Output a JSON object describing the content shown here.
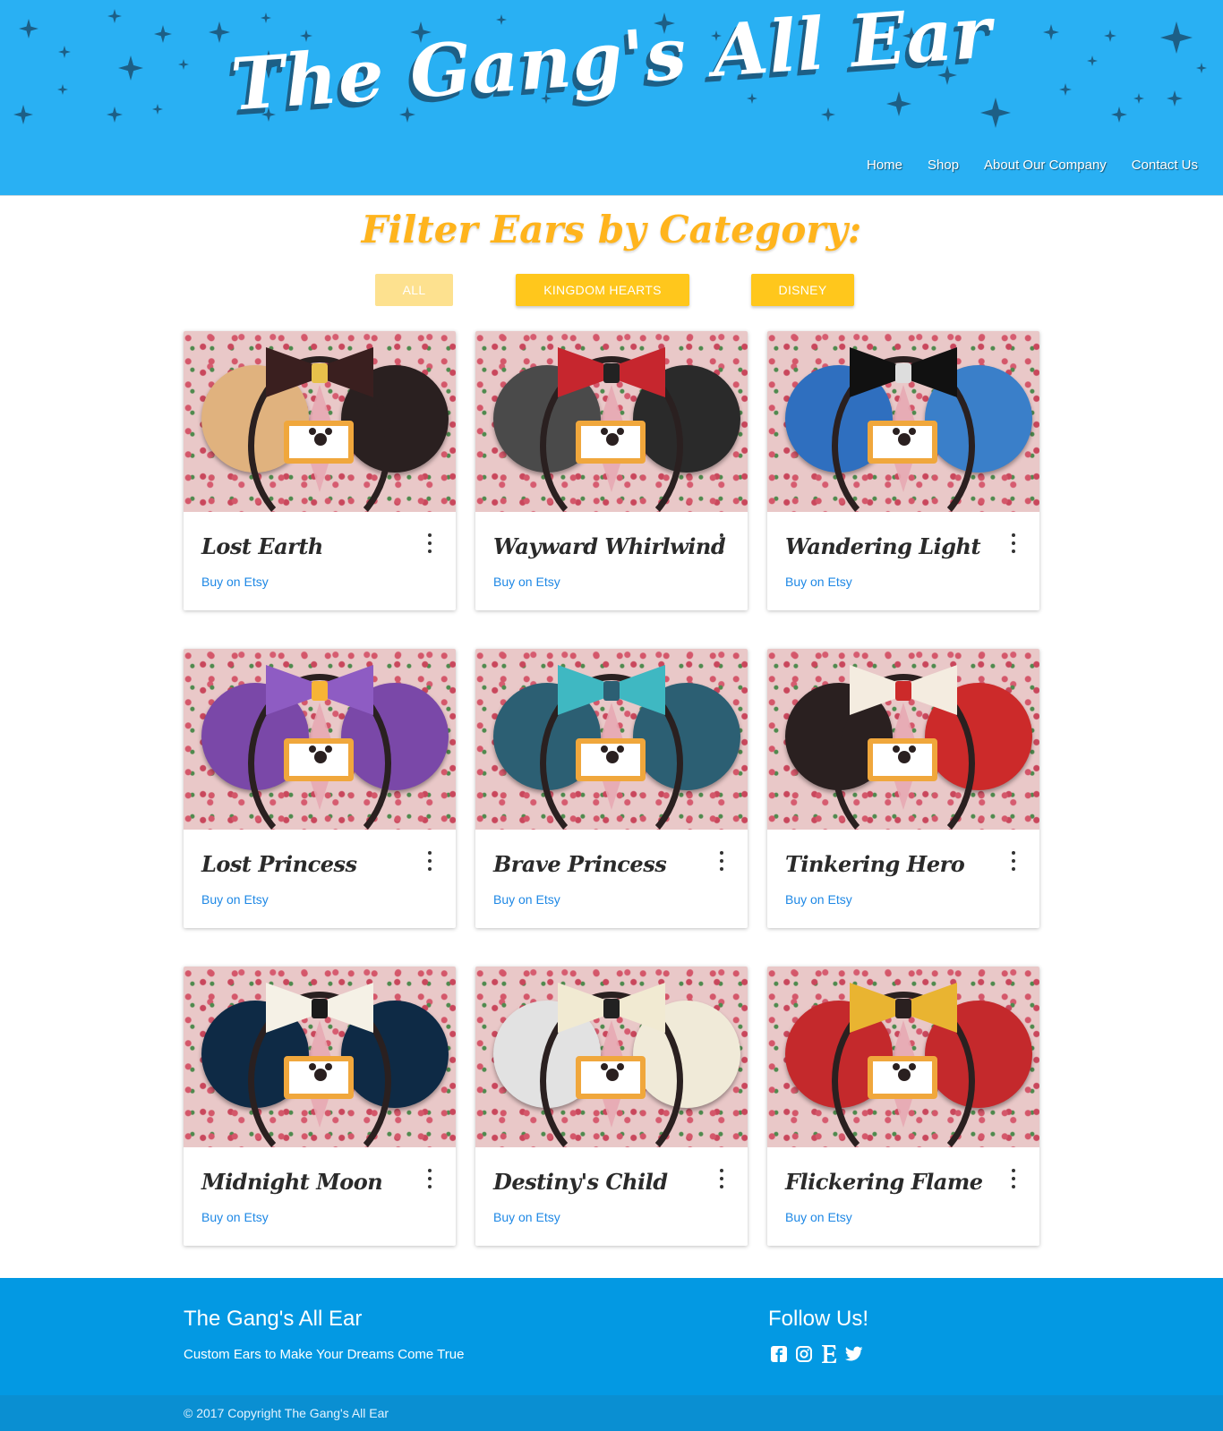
{
  "header": {
    "logo_text": "The Gang's All Ear",
    "nav": [
      "Home",
      "Shop",
      "About Our Company",
      "Contact Us"
    ]
  },
  "filter": {
    "title": "Filter Ears by Category:",
    "buttons": [
      "ALL",
      "KINGDOM HEARTS",
      "DISNEY"
    ],
    "active": "ALL"
  },
  "products": [
    {
      "name": "Lost Earth",
      "link": "Buy on Etsy",
      "ear_left": "#e0b27e",
      "ear_right": "#2a2020",
      "bow": "#3a1f1f",
      "knot": "#e7c04b"
    },
    {
      "name": "Wayward Whirlwind",
      "link": "Buy on Etsy",
      "ear_left": "#4a4a4a",
      "ear_right": "#2a2a2a",
      "bow": "#c6262e",
      "knot": "#222222"
    },
    {
      "name": "Wandering Light",
      "link": "Buy on Etsy",
      "ear_left": "#2f6fbf",
      "ear_right": "#3a7fc9",
      "bow": "#111111",
      "knot": "#dddddd"
    },
    {
      "name": "Lost Princess",
      "link": "Buy on Etsy",
      "ear_left": "#7a48a8",
      "ear_right": "#7a48a8",
      "bow": "#8e5cc3",
      "knot": "#f7b436"
    },
    {
      "name": "Brave Princess",
      "link": "Buy on Etsy",
      "ear_left": "#2c5f73",
      "ear_right": "#2c5f73",
      "bow": "#3fb8c2",
      "knot": "#2c5f73"
    },
    {
      "name": "Tinkering Hero",
      "link": "Buy on Etsy",
      "ear_left": "#2a2020",
      "ear_right": "#cc2a2a",
      "bow": "#f4ece0",
      "knot": "#cc2a2a"
    },
    {
      "name": "Midnight Moon",
      "link": "Buy on Etsy",
      "ear_left": "#0e2a45",
      "ear_right": "#0e2a45",
      "bow": "#f5f1e6",
      "knot": "#1b1b1b"
    },
    {
      "name": "Destiny's Child",
      "link": "Buy on Etsy",
      "ear_left": "#e2e2e2",
      "ear_right": "#f0ead8",
      "bow": "#f1ead2",
      "knot": "#222222"
    },
    {
      "name": "Flickering Flame",
      "link": "Buy on Etsy",
      "ear_left": "#c4292c",
      "ear_right": "#c4292c",
      "bow": "#e9b431",
      "knot": "#2a2020"
    }
  ],
  "footer": {
    "brand": "The Gang's All Ear",
    "tagline": "Custom Ears to Make Your Dreams Come True",
    "follow_title": "Follow Us!",
    "social_icons": [
      "facebook-icon",
      "instagram-icon",
      "etsy-icon",
      "twitter-icon"
    ],
    "copyright": "© 2017 Copyright The Gang's All Ear"
  },
  "colors": {
    "header_bg": "#29b0f3",
    "star": "#1d5f86",
    "filter_title": "#ffb41d",
    "filter_button": "#ffc71c",
    "filter_button_active": "#fde18f",
    "link": "#1e88e5",
    "footer_bg": "#0399e3",
    "copyright_bg": "#0a8fd2"
  }
}
